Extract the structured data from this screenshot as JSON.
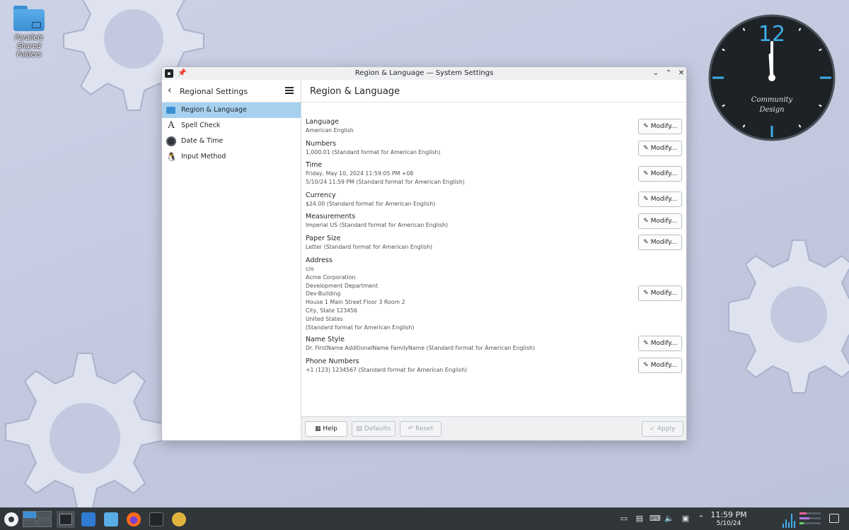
{
  "desktop": {
    "folder_label": "Parallels Shared Folders",
    "clock_widget": {
      "hour_mark": "12",
      "caption_line1": "Community",
      "caption_line2": "Design"
    }
  },
  "window": {
    "title": "Region & Language — System Settings",
    "sidebar": {
      "title": "Regional Settings",
      "items": [
        {
          "label": "Region & Language",
          "icon": "chat-bubble-icon",
          "active": true
        },
        {
          "label": "Spell Check",
          "icon": "spell-check-icon",
          "active": false
        },
        {
          "label": "Date & Time",
          "icon": "clock-icon",
          "active": false
        },
        {
          "label": "Input Method",
          "icon": "penguin-icon",
          "active": false
        }
      ]
    },
    "content": {
      "title": "Region & Language",
      "modify_label": "Modify...",
      "settings": [
        {
          "name": "Language",
          "value": "American English"
        },
        {
          "name": "Numbers",
          "value": "1,000.01 (Standard format for American English)"
        },
        {
          "name": "Time",
          "value": "Friday, May 10, 2024 11:59:05 PM +08\n5/10/24 11:59 PM (Standard format for American English)"
        },
        {
          "name": "Currency",
          "value": "$24.00 (Standard format for American English)"
        },
        {
          "name": "Measurements",
          "value": "Imperial US (Standard format for American English)"
        },
        {
          "name": "Paper Size",
          "value": "Letter (Standard format for American English)"
        },
        {
          "name": "Address",
          "value": "c/o\nAcme Corporation\nDevelopment Department\nDev-Building\nHouse 1 Main Street Floor 3 Room 2\nCity, State 123456\nUnited States\n (Standard format for American English)"
        },
        {
          "name": "Name Style",
          "value": "Dr. FirstName AdditionalName FamilyName (Standard format for American English)"
        },
        {
          "name": "Phone Numbers",
          "value": "+1 (123) 1234567 (Standard format for American English)"
        }
      ]
    },
    "footer": {
      "help": "Help",
      "defaults": "Defaults",
      "reset": "Reset",
      "apply": "Apply"
    }
  },
  "taskbar": {
    "time": "11:59 PM",
    "date": "5/10/24"
  },
  "colors": {
    "accent": "#3d8fd4",
    "selection": "#a6d1ee",
    "panel": "#31363b"
  }
}
